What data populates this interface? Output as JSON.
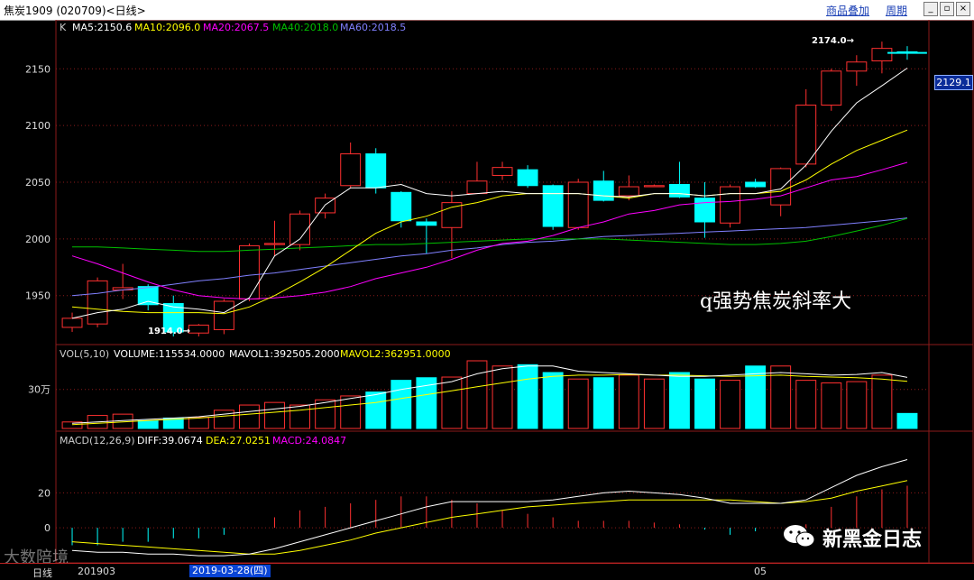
{
  "window": {
    "title": "焦炭1909 (020709)<日线>",
    "links": [
      "商品叠加",
      "周期"
    ],
    "buttons": [
      "minimize",
      "restore",
      "close"
    ]
  },
  "colors": {
    "up": "#ff3030",
    "down": "#00ffff",
    "ma5": "#ffffff",
    "ma10": "#ffff00",
    "ma20": "#ff00ff",
    "ma40": "#00c000",
    "ma60": "#8080ff",
    "grid": "#8b1a1a"
  },
  "main_legend": {
    "k": "K",
    "ma5": "MA5:2150.6",
    "ma10": "MA10:2096.0",
    "ma20": "MA20:2067.5",
    "ma40": "MA40:2018.0",
    "ma60": "MA60:2018.5"
  },
  "vol_legend": {
    "title": "VOL(5,10)",
    "volume": "VOLUME:115534.0000",
    "mavol1": "MAVOL1:392505.2000",
    "mavol2": "MAVOL2:362951.0000"
  },
  "macd_legend": {
    "title": "MACD(12,26,9)",
    "diff": "DIFF:39.0674",
    "dea": "DEA:27.0251",
    "macd": "MACD:24.0847"
  },
  "annotations": {
    "high": "2174.0→",
    "low": "1914.0→",
    "last_price": "2129.1",
    "overlay_text": "q强势焦炭斜率大",
    "brand": "新黑金日志",
    "watermark": "大数陪境"
  },
  "footer": {
    "period": "日线",
    "start_label": "201903",
    "cursor_date": "2019-03-28(四)",
    "month_label": "05"
  },
  "chart_data": [
    {
      "type": "candlestick",
      "title": "焦炭1909 日线",
      "y_ticks": [
        1950,
        2000,
        2050,
        2100,
        2150
      ],
      "ylim": [
        1910,
        2190
      ],
      "candles": [
        {
          "o": 1922,
          "h": 1935,
          "l": 1918,
          "c": 1930
        },
        {
          "o": 1925,
          "h": 1966,
          "l": 1922,
          "c": 1963
        },
        {
          "o": 1955,
          "h": 1978,
          "l": 1947,
          "c": 1957
        },
        {
          "o": 1958,
          "h": 1960,
          "l": 1937,
          "c": 1942
        },
        {
          "o": 1943,
          "h": 1950,
          "l": 1914,
          "c": 1918
        },
        {
          "o": 1917,
          "h": 1925,
          "l": 1914,
          "c": 1924
        },
        {
          "o": 1920,
          "h": 1947,
          "l": 1916,
          "c": 1945
        },
        {
          "o": 1947,
          "h": 1996,
          "l": 1945,
          "c": 1994
        },
        {
          "o": 1995,
          "h": 2016,
          "l": 1985,
          "c": 1996
        },
        {
          "o": 1995,
          "h": 2025,
          "l": 1990,
          "c": 2022
        },
        {
          "o": 2023,
          "h": 2040,
          "l": 2018,
          "c": 2036
        },
        {
          "o": 2047,
          "h": 2085,
          "l": 2045,
          "c": 2075
        },
        {
          "o": 2075,
          "h": 2080,
          "l": 2040,
          "c": 2045
        },
        {
          "o": 2041,
          "h": 2042,
          "l": 2010,
          "c": 2016
        },
        {
          "o": 2015,
          "h": 2018,
          "l": 1987,
          "c": 2012
        },
        {
          "o": 2010,
          "h": 2042,
          "l": 1983,
          "c": 2032
        },
        {
          "o": 2040,
          "h": 2068,
          "l": 2040,
          "c": 2051
        },
        {
          "o": 2056,
          "h": 2068,
          "l": 2052,
          "c": 2063
        },
        {
          "o": 2061,
          "h": 2065,
          "l": 2045,
          "c": 2047
        },
        {
          "o": 2047,
          "h": 2048,
          "l": 2008,
          "c": 2011
        },
        {
          "o": 2010,
          "h": 2053,
          "l": 2008,
          "c": 2050
        },
        {
          "o": 2051,
          "h": 2060,
          "l": 2033,
          "c": 2034
        },
        {
          "o": 2038,
          "h": 2056,
          "l": 2034,
          "c": 2046
        },
        {
          "o": 2046,
          "h": 2048,
          "l": 2046,
          "c": 2047
        },
        {
          "o": 2048,
          "h": 2068,
          "l": 2036,
          "c": 2037
        },
        {
          "o": 2036,
          "h": 2050,
          "l": 2001,
          "c": 2015
        },
        {
          "o": 2014,
          "h": 2048,
          "l": 2010,
          "c": 2046
        },
        {
          "o": 2050,
          "h": 2053,
          "l": 2045,
          "c": 2046
        },
        {
          "o": 2030,
          "h": 2063,
          "l": 2020,
          "c": 2062
        },
        {
          "o": 2066,
          "h": 2132,
          "l": 2063,
          "c": 2118
        },
        {
          "o": 2118,
          "h": 2150,
          "l": 2113,
          "c": 2148
        },
        {
          "o": 2148,
          "h": 2162,
          "l": 2135,
          "c": 2156
        },
        {
          "o": 2157,
          "h": 2174,
          "l": 2146,
          "c": 2168
        },
        {
          "o": 2165,
          "h": 2170,
          "l": 2158,
          "c": 2164
        }
      ],
      "ma5": [
        1930,
        1935,
        1938,
        1945,
        1940,
        1938,
        1935,
        1948,
        1985,
        2000,
        2030,
        2045,
        2045,
        2048,
        2040,
        2038,
        2040,
        2042,
        2040,
        2040,
        2040,
        2038,
        2037,
        2040,
        2040,
        2038,
        2040,
        2040,
        2044,
        2065,
        2095,
        2120,
        2135,
        2150.6
      ],
      "ma10": [
        1940,
        1938,
        1936,
        1935,
        1935,
        1935,
        1934,
        1940,
        1950,
        1962,
        1975,
        1990,
        2005,
        2015,
        2020,
        2028,
        2032,
        2038,
        2040,
        2040,
        2040,
        2038,
        2036,
        2040,
        2040,
        2038,
        2040,
        2040,
        2042,
        2052,
        2066,
        2078,
        2087,
        2096.0
      ],
      "ma20": [
        1985,
        1978,
        1970,
        1962,
        1955,
        1950,
        1948,
        1947,
        1948,
        1950,
        1953,
        1958,
        1965,
        1970,
        1975,
        1982,
        1990,
        1996,
        1998,
        2003,
        2010,
        2015,
        2022,
        2025,
        2030,
        2032,
        2033,
        2035,
        2038,
        2045,
        2052,
        2055,
        2061,
        2067.5
      ],
      "ma40": [
        1993,
        1993,
        1992,
        1991,
        1990,
        1989,
        1989,
        1990,
        1991,
        1992,
        1993,
        1994,
        1995,
        1995,
        1996,
        1997,
        1998,
        1999,
        2000,
        2000,
        2000,
        2000,
        1999,
        1998,
        1997,
        1996,
        1995,
        1995,
        1996,
        1998,
        2002,
        2007,
        2012,
        2018.0
      ],
      "ma60": [
        1950,
        1952,
        1955,
        1957,
        1960,
        1963,
        1965,
        1968,
        1970,
        1973,
        1976,
        1979,
        1982,
        1985,
        1987,
        1990,
        1992,
        1995,
        1997,
        1998,
        2000,
        2002,
        2003,
        2004,
        2005,
        2006,
        2007,
        2008,
        2009,
        2010,
        2012,
        2014,
        2016,
        2018.5
      ]
    },
    {
      "type": "bar",
      "title": "VOL(5,10)",
      "y_ticks": [
        300000
      ],
      "y_tick_labels": [
        "30万"
      ],
      "ylim": [
        0,
        520000
      ],
      "volume": [
        50000,
        100000,
        110000,
        60000,
        80000,
        85000,
        140000,
        180000,
        200000,
        180000,
        220000,
        250000,
        280000,
        370000,
        390000,
        395000,
        560000,
        480000,
        490000,
        430000,
        380000,
        390000,
        410000,
        380000,
        430000,
        380000,
        370000,
        480000,
        480000,
        370000,
        350000,
        360000,
        410000,
        115534
      ],
      "mavol1": [
        40000,
        50000,
        60000,
        70000,
        80000,
        90000,
        110000,
        130000,
        150000,
        170000,
        200000,
        230000,
        260000,
        300000,
        330000,
        360000,
        420000,
        460000,
        480000,
        480000,
        440000,
        430000,
        420000,
        410000,
        400000,
        400000,
        410000,
        420000,
        430000,
        420000,
        410000,
        415000,
        430000,
        392505
      ],
      "mavol2": [
        30000,
        40000,
        50000,
        60000,
        70000,
        80000,
        95000,
        110000,
        125000,
        140000,
        160000,
        180000,
        200000,
        230000,
        260000,
        290000,
        320000,
        350000,
        380000,
        400000,
        410000,
        410000,
        415000,
        410000,
        410000,
        405000,
        400000,
        405000,
        410000,
        400000,
        395000,
        390000,
        380000,
        362951
      ]
    },
    {
      "type": "line",
      "title": "MACD(12,26,9)",
      "y_ticks": [
        0,
        20
      ],
      "ylim": [
        -18,
        45
      ],
      "diff": [
        -13,
        -14,
        -14,
        -15,
        -15,
        -16,
        -16,
        -15,
        -12,
        -8,
        -4,
        0,
        4,
        8,
        12,
        15,
        15,
        15,
        15,
        16,
        18,
        20,
        21,
        20,
        19,
        17,
        14,
        14,
        14,
        16,
        23,
        30,
        35,
        39.07
      ],
      "dea": [
        -8,
        -9,
        -10,
        -11,
        -12,
        -13,
        -14,
        -15,
        -15,
        -13,
        -10,
        -7,
        -3,
        0,
        3,
        6,
        8,
        10,
        12,
        13,
        14,
        15,
        16,
        16,
        16,
        16,
        16,
        15,
        14,
        15,
        17,
        21,
        24,
        27.03
      ],
      "macd": [
        -10,
        -10,
        -8,
        -8,
        -6,
        -6,
        -4,
        0,
        6,
        10,
        12,
        14,
        16,
        18,
        18,
        16,
        14,
        10,
        8,
        6,
        4,
        4,
        4,
        3,
        2,
        -1,
        -4,
        -2,
        0,
        2,
        12,
        18,
        22,
        24.08
      ]
    }
  ]
}
